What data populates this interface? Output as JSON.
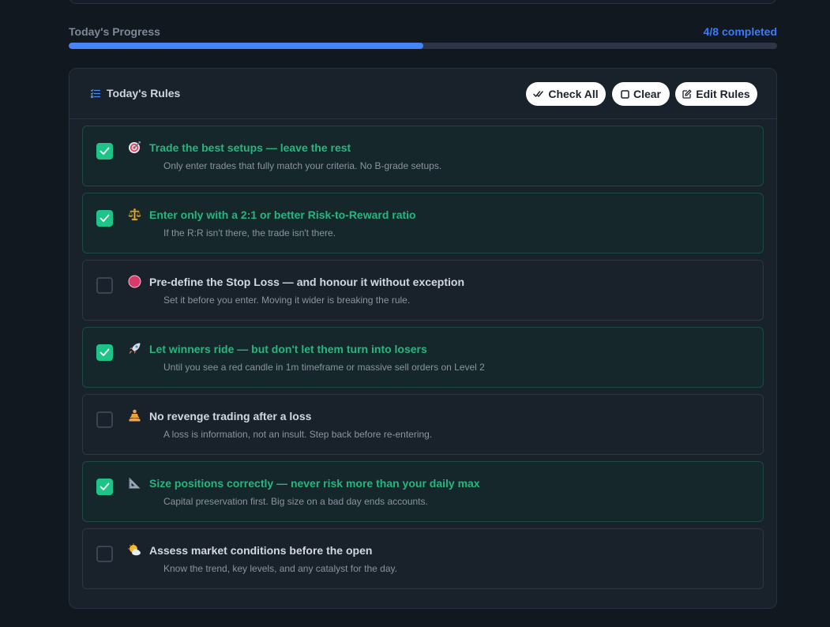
{
  "progress": {
    "label": "Today's Progress",
    "count_text": "4/8 completed",
    "completed": 4,
    "total": 8,
    "fill_color": "#4684f7"
  },
  "rules_card": {
    "title": "Today's Rules",
    "title_icon": "list-check-icon",
    "buttons": {
      "check_all": {
        "label": "Check All",
        "icon": "double-check-icon"
      },
      "clear": {
        "label": "Clear",
        "icon": "square-icon"
      },
      "edit": {
        "label": "Edit Rules",
        "icon": "edit-icon"
      }
    }
  },
  "rules": [
    {
      "checked": true,
      "emoji": "target-icon",
      "title": "Trade the best setups — leave the rest",
      "description": "Only enter trades that fully match your criteria. No B-grade setups."
    },
    {
      "checked": true,
      "emoji": "scales-icon",
      "title": "Enter only with a 2:1 or better Risk-to-Reward ratio",
      "description": "If the R:R isn't there, the trade isn't there."
    },
    {
      "checked": false,
      "emoji": "red-circle-icon",
      "title": "Pre-define the Stop Loss — and honour it without exception",
      "description": "Set it before you enter. Moving it wider is breaking the rule."
    },
    {
      "checked": true,
      "emoji": "rocket-icon",
      "title": "Let winners ride — but don't let them turn into losers",
      "description": "Until you see a red candle in 1m timeframe or massive sell orders on Level 2"
    },
    {
      "checked": false,
      "emoji": "meditation-icon",
      "title": "No revenge trading after a loss",
      "description": "A loss is information, not an insult. Step back before re-entering."
    },
    {
      "checked": true,
      "emoji": "triangle-ruler-icon",
      "title": "Size positions correctly — never risk more than your daily max",
      "description": "Capital preservation first. Big size on a bad day ends accounts."
    },
    {
      "checked": false,
      "emoji": "sun-cloud-icon",
      "title": "Assess market conditions before the open",
      "description": "Know the trend, key levels, and any catalyst for the day."
    }
  ],
  "colors": {
    "accent_green": "#1ec387",
    "accent_blue": "#3d7bf3",
    "background": "#121820"
  }
}
